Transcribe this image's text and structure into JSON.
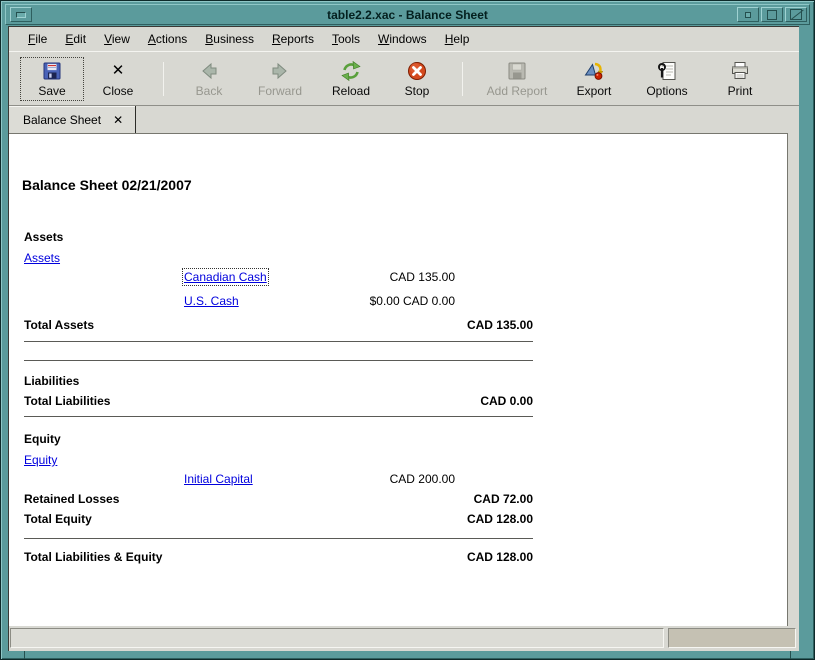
{
  "colors": {
    "titlebar_teal": "#5b9b9c",
    "link_blue": "#0000dd",
    "stop_red": "#d44a1e",
    "reload_green": "#4e9a2e",
    "chrome_gray": "#d8d8d2"
  },
  "window": {
    "title": "table2.2.xac - Balance Sheet",
    "controls": {
      "menu_icon": "window-menu-icon",
      "minimize_icon": "minimize-icon",
      "maximize_icon": "maximize-icon",
      "close_icon": "close-icon"
    }
  },
  "menu": {
    "items": [
      {
        "label": "File",
        "first": "F",
        "rest": "ile"
      },
      {
        "label": "Edit",
        "first": "E",
        "rest": "dit"
      },
      {
        "label": "View",
        "first": "V",
        "rest": "iew"
      },
      {
        "label": "Actions",
        "first": "A",
        "rest": "ctions"
      },
      {
        "label": "Business",
        "first": "B",
        "rest": "usiness"
      },
      {
        "label": "Reports",
        "first": "R",
        "rest": "eports"
      },
      {
        "label": "Tools",
        "first": "T",
        "rest": "ools"
      },
      {
        "label": "Windows",
        "first": "W",
        "rest": "indows"
      },
      {
        "label": "Help",
        "first": "H",
        "rest": "elp"
      }
    ]
  },
  "toolbar": {
    "buttons": [
      {
        "label": "Save",
        "icon": "floppy-save-icon",
        "disabled": false,
        "focused": true
      },
      {
        "label": "Close",
        "icon": "close-x-icon",
        "disabled": false
      },
      {
        "label": "Back",
        "icon": "arrow-left-icon",
        "disabled": true
      },
      {
        "label": "Forward",
        "icon": "arrow-right-icon",
        "disabled": true
      },
      {
        "label": "Reload",
        "icon": "refresh-arrows-icon",
        "disabled": false
      },
      {
        "label": "Stop",
        "icon": "stop-circle-icon",
        "disabled": false
      },
      {
        "label": "Add Report",
        "icon": "floppy-add-report-icon",
        "disabled": true
      },
      {
        "label": "Export",
        "icon": "export-shapes-icon",
        "disabled": false
      },
      {
        "label": "Options",
        "icon": "options-wrench-icon",
        "disabled": false
      },
      {
        "label": "Print",
        "icon": "printer-icon",
        "disabled": false
      }
    ]
  },
  "tabs": {
    "active": {
      "label": "Balance Sheet",
      "close_glyph": "✕"
    }
  },
  "report": {
    "title": "Balance Sheet 02/21/2007",
    "assets": {
      "heading": "Assets",
      "parent_link": "Assets",
      "accounts": [
        {
          "name": "Canadian Cash",
          "amount": "CAD 135.00"
        },
        {
          "name": "U.S. Cash",
          "amount": "$0.00 CAD 0.00"
        }
      ],
      "total_label": "Total Assets",
      "total_amount": "CAD 135.00"
    },
    "liabilities": {
      "heading": "Liabilities",
      "total_label": "Total Liabilities",
      "total_amount": "CAD 0.00"
    },
    "equity": {
      "heading": "Equity",
      "parent_link": "Equity",
      "accounts": [
        {
          "name": "Initial Capital",
          "amount": "CAD 200.00"
        }
      ],
      "retained_label": "Retained Losses",
      "retained_amount": "CAD 72.00",
      "total_label": "Total Equity",
      "total_amount": "CAD 128.00"
    },
    "grand_total": {
      "label": "Total Liabilities & Equity",
      "amount": "CAD 128.00"
    }
  }
}
